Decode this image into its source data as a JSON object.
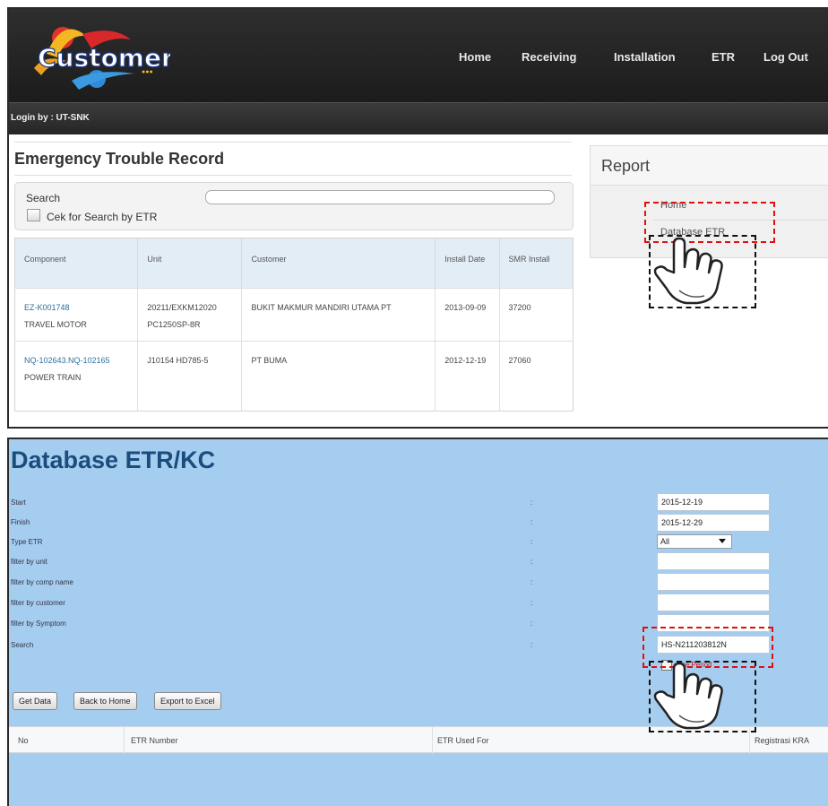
{
  "app": {
    "logo_text": "Customer",
    "nav": [
      "Home",
      "Receiving",
      "Installation",
      "ETR",
      "Log Out"
    ],
    "login_text": "Login by : UT-SNK"
  },
  "etr": {
    "title": "Emergency Trouble Record",
    "search_label": "Search",
    "search_value": "",
    "checkbox_label": "Cek for Search by ETR",
    "columns": [
      "Component",
      "Unit",
      "Customer",
      "Install Date",
      "SMR Install"
    ],
    "rows": [
      {
        "component_code": "EZ-K001748",
        "component_name": "TRAVEL MOTOR",
        "unit": "20211/EXKM12020 PC1250SP-8R",
        "customer": "BUKIT MAKMUR MANDIRI UTAMA PT",
        "install_date": "2013-09-09",
        "smr": "37200"
      },
      {
        "component_code": "NQ-102643.NQ-102165",
        "component_name": "POWER TRAIN",
        "unit": "J10154 HD785-5",
        "customer": "PT BUMA",
        "install_date": "2012-12-19",
        "smr": "27060"
      }
    ]
  },
  "report": {
    "title": "Report",
    "items": [
      "Home",
      "Database ETR"
    ]
  },
  "database": {
    "title": "Database ETR/KC",
    "filters": [
      {
        "label": "Start",
        "value": "2015-12-19"
      },
      {
        "label": "Finish",
        "value": "2015-12-29"
      },
      {
        "label": "Type ETR",
        "value": "All"
      },
      {
        "label": "filter by unit",
        "value": ""
      },
      {
        "label": "filter by comp name",
        "value": ""
      },
      {
        "label": "filter by customer",
        "value": ""
      },
      {
        "label": "filter by Symptom",
        "value": ""
      },
      {
        "label": "Search",
        "value": "HS-N211203812N"
      }
    ],
    "colon": ":",
    "use_period_label": "Use Period",
    "buttons": [
      "Get Data",
      "Back to Home",
      "Export to Excel"
    ],
    "result_columns": [
      "No",
      "ETR Number",
      "ETR Used For",
      "Registrasi KRA"
    ]
  },
  "colors": {
    "nav_bg": "#1f1f1f",
    "link": "#2e6f9e",
    "db_bg": "#a5cdf0",
    "db_title": "#1a4d7c",
    "highlight": "#e01010"
  }
}
